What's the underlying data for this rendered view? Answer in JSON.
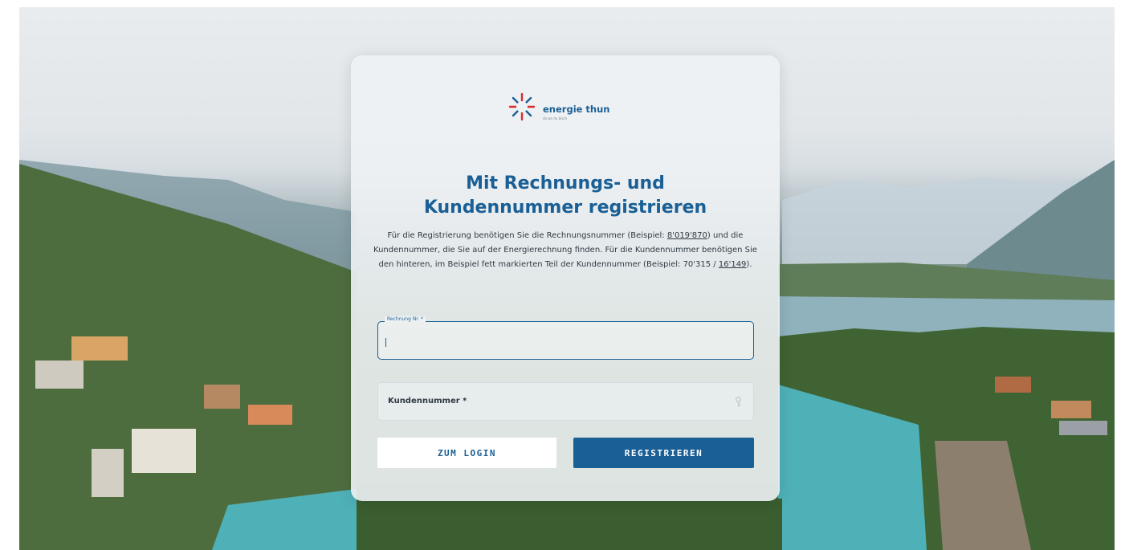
{
  "brand": {
    "name": "energie thun",
    "tagline": "da wo du bisch",
    "colors": {
      "primary": "#1a5f95",
      "accent_red": "#d92b2b"
    }
  },
  "form": {
    "title_line1": "Mit Rechnungs- und",
    "title_line2": "Kundennummer registrieren",
    "description": {
      "part1": "Für die Registrierung benötigen Sie die Rechnungsnummer (Beispiel: ",
      "invoice_example": "8'019'870",
      "part2": ") und die Kundennummer, die Sie auf der Energierechnung finden. Für die Kundennummer benötigen Sie den hinteren, im Beispiel fett markierten Teil der Kundennummer (Beispiel: 70'315 / ",
      "customer_example": "16'149",
      "part3": ")."
    },
    "invoice_field": {
      "label": "Rechnung Nr. *",
      "value": ""
    },
    "customer_field": {
      "label": "Kundennummer *",
      "value": "",
      "icon": "key-icon"
    },
    "buttons": {
      "login": "ZUM LOGIN",
      "register": "REGISTRIEREN"
    }
  }
}
